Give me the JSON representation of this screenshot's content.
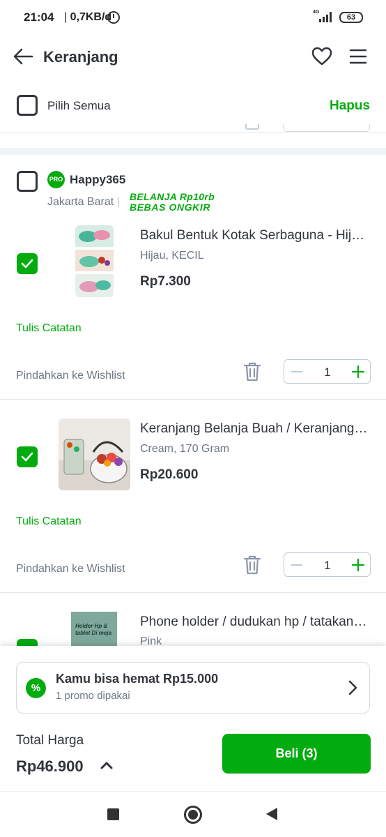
{
  "status_bar": {
    "time": "21:04",
    "network_speed": "0,7KB/d",
    "signal_label": "4G",
    "battery": "63"
  },
  "header": {
    "title": "Keranjang"
  },
  "select_all": {
    "label": "Pilih Semua",
    "delete_label": "Hapus"
  },
  "shop": {
    "badge": "PRO",
    "name": "Happy365",
    "location": "Jakarta Barat",
    "promo_line1": "BELANJA Rp10rb",
    "promo_line2": "BEBAS ONGKIR"
  },
  "items": [
    {
      "name": "Bakul Bentuk Kotak Serbaguna - Hijau, KECIL",
      "variant": "Hijau, KECIL",
      "price": "Rp7.300",
      "note_label": "Tulis Catatan",
      "wishlist_label": "Pindahkan ke Wishlist",
      "quantity": "1",
      "checked": true
    },
    {
      "name": "Keranjang Belanja Buah / Keranjang Serbaguna",
      "variant": "Cream, 170 Gram",
      "price": "Rp20.600",
      "note_label": "Tulis Catatan",
      "wishlist_label": "Pindahkan ke Wishlist",
      "quantity": "1",
      "checked": true
    },
    {
      "name": "Phone holder / dudukan hp / tatakan hp",
      "variant": "Pink",
      "image_text": "Holder Hp & tablet Di meja",
      "checked": true
    }
  ],
  "promo": {
    "title": "Kamu bisa hemat Rp15.000",
    "subtitle": "1 promo dipakai"
  },
  "checkout": {
    "total_label": "Total Harga",
    "total_value": "Rp46.900",
    "buy_label": "Beli (3)"
  },
  "colors": {
    "accent": "#03ac0e",
    "text": "#31353b",
    "muted": "#6d7588"
  }
}
